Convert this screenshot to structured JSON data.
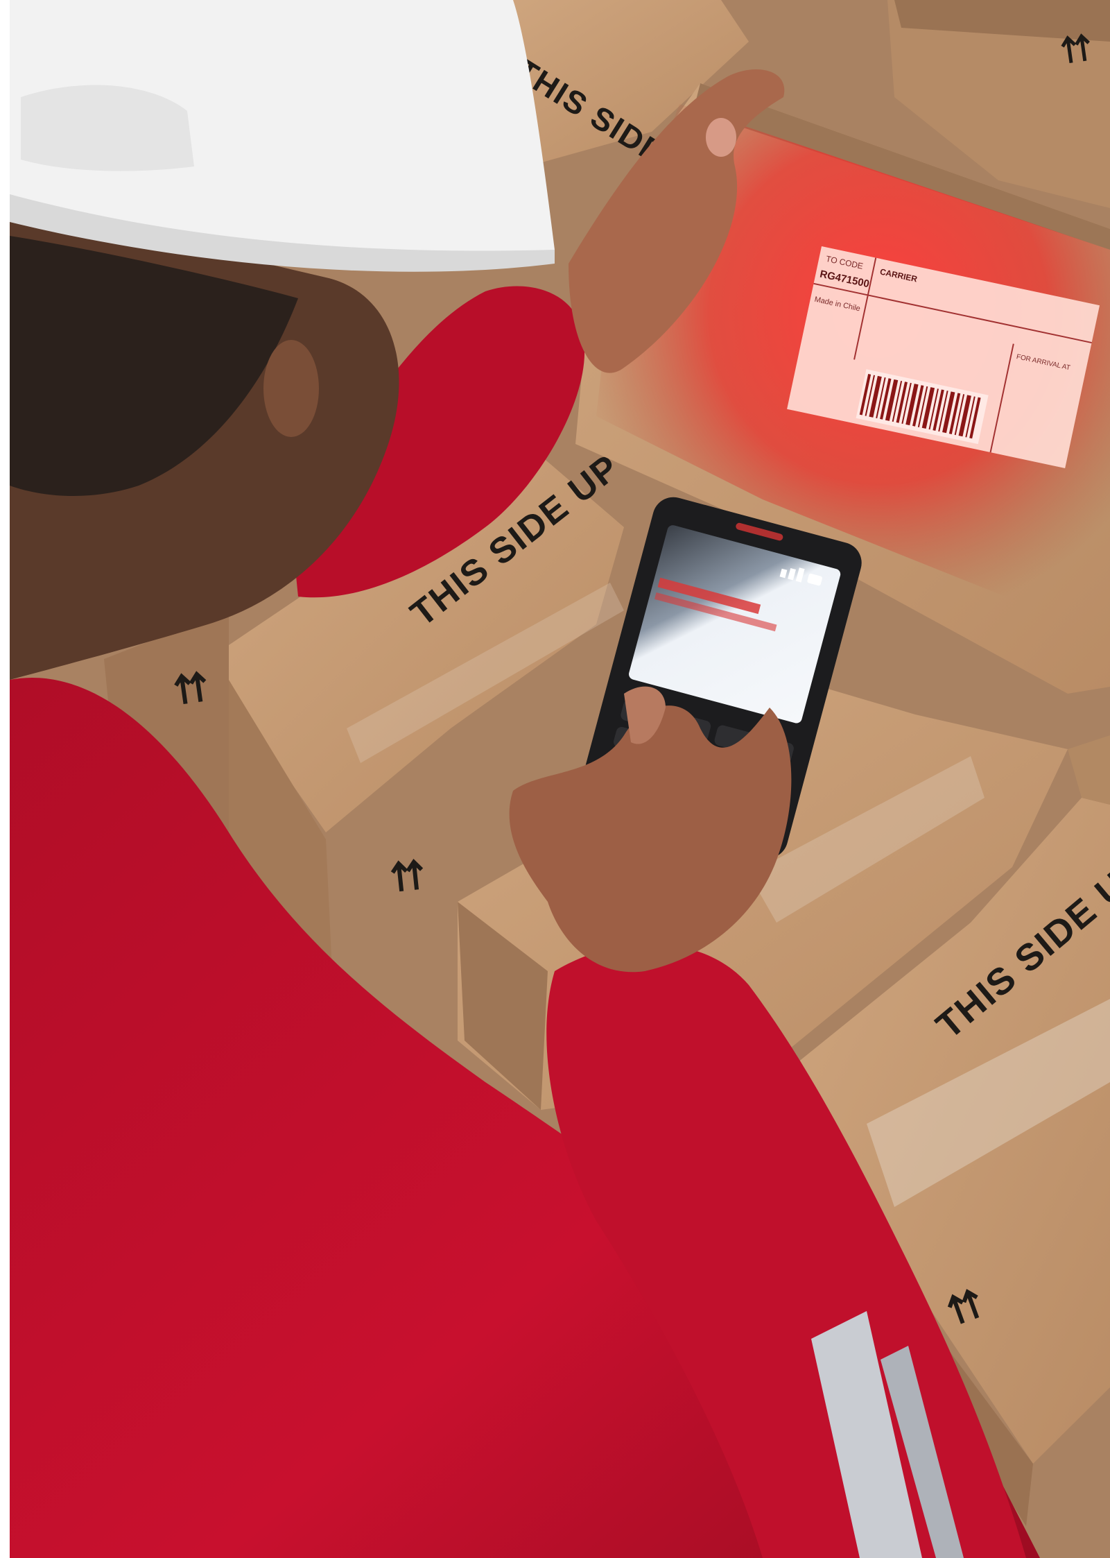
{
  "scene": {
    "type": "photograph",
    "colors": {
      "background_white": "#ffffff",
      "cardboard": "#c49a74",
      "cardboard_shadow": "#8f6a4c",
      "jacket_red": "#c8102e",
      "jacket_dark": "#8a0c1f",
      "helmet_white": "#f2f2f2",
      "laser_red": "#ff2a2a",
      "device_black": "#1c1c1e",
      "screen_white": "#eef2f7",
      "reflective_stripe": "#c9ccd2"
    }
  },
  "boxes": {
    "stencil_text": "THIS SIDE UP",
    "stencil_top_partial": "THIS SIDE U",
    "orientation_arrows_icon": "up-arrows-icon"
  },
  "shipping_label": {
    "code": "RG471500",
    "field_top_left": "TO CODE",
    "carrier": "CARRIER",
    "left_note": "Made in Chile",
    "right_top": "FOR ARRIVAL AT",
    "barcode_icon": "barcode-icon"
  },
  "scanner": {
    "screen_icon": "signal-bars-icon",
    "keypad_icon": "keypad-icon"
  }
}
